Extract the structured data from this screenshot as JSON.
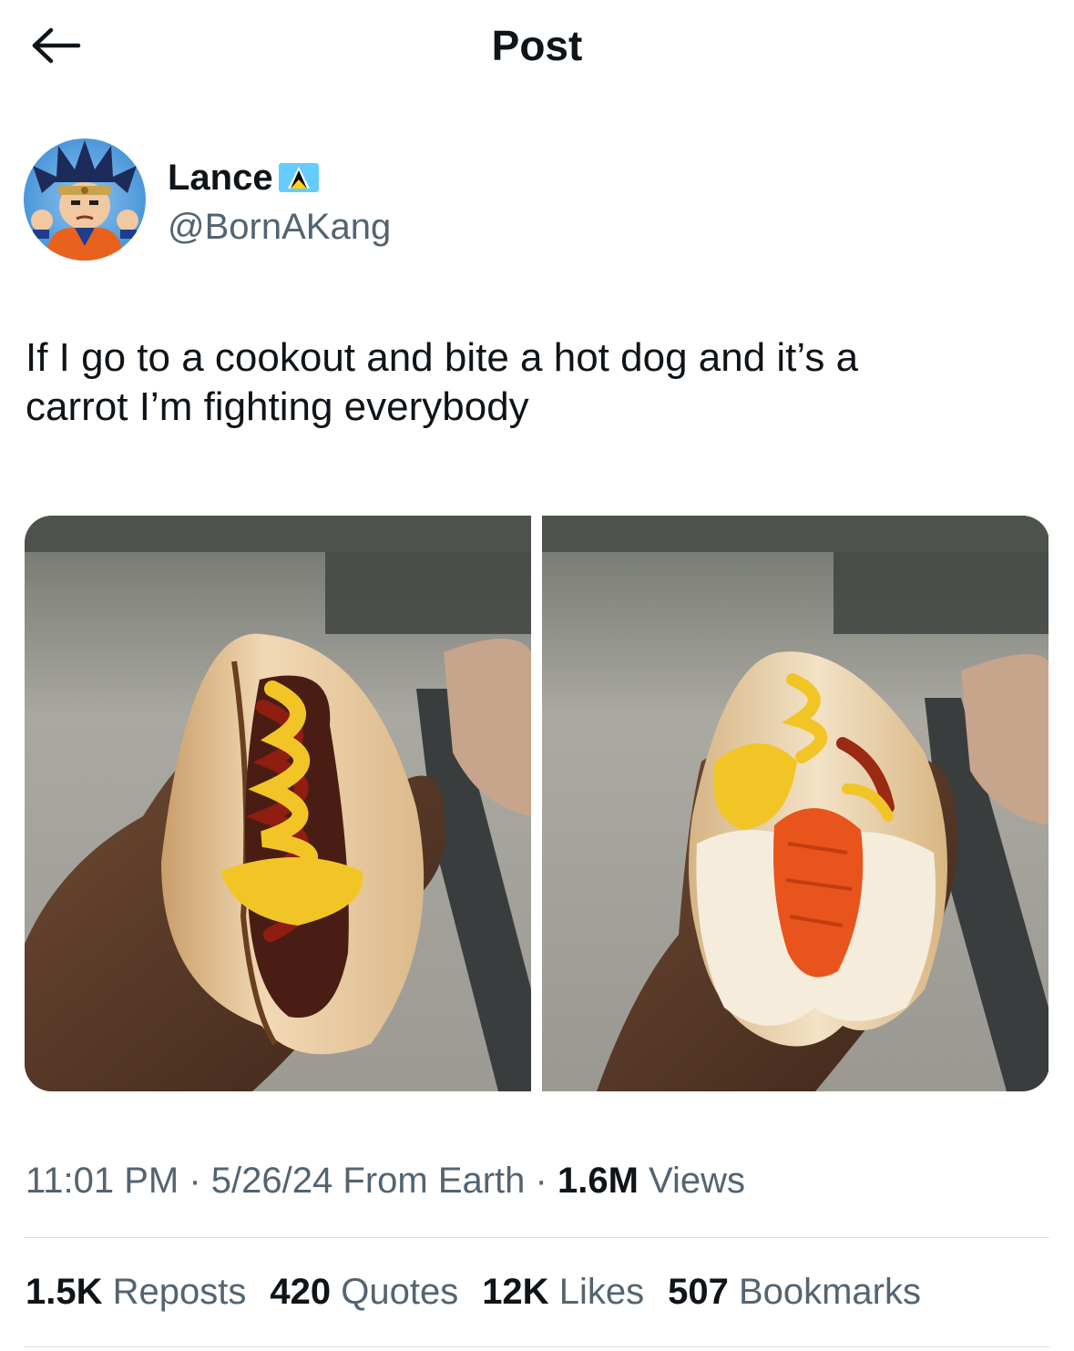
{
  "header": {
    "title": "Post",
    "back_icon": "arrow-left-icon"
  },
  "author": {
    "display_name": "Lance",
    "flag_icon": "saint-lucia-flag-icon",
    "handle": "@BornAKang"
  },
  "tweet": {
    "text": "If I go to a cookout and bite a hot dog and it’s a\ncarrot I’m fighting everybody"
  },
  "media": {
    "count": 2
  },
  "meta": {
    "time": "11:01 PM",
    "sep1": " · ",
    "date": "5/26/24",
    "source": " From Earth",
    "sep2": " · ",
    "views_count": "1.6M",
    "views_label": " Views"
  },
  "stats": {
    "reposts_count": "1.5K",
    "reposts_label": " Reposts",
    "quotes_count": "420",
    "quotes_label": " Quotes",
    "likes_count": "12K",
    "likes_label": " Likes",
    "bookmarks_count": "507",
    "bookmarks_label": " Bookmarks"
  },
  "colors": {
    "text": "#0f1419",
    "secondary": "#536471",
    "divider": "#d9dee2",
    "mustard": "#f2c526",
    "ketchup": "#8f1d10",
    "carrot": "#e8541b",
    "bun": "#e9c99a"
  }
}
